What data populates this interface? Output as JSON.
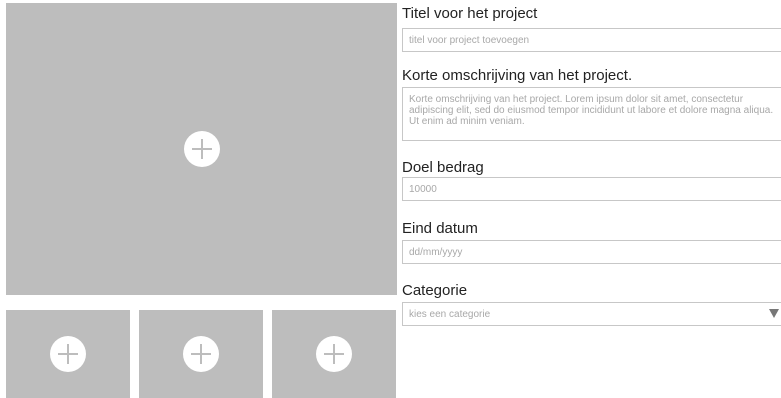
{
  "media": {
    "main": {
      "icon": "plus-circle-icon"
    },
    "thumbnails": [
      {
        "icon": "plus-circle-icon"
      },
      {
        "icon": "plus-circle-icon"
      },
      {
        "icon": "plus-circle-icon"
      }
    ]
  },
  "form": {
    "title": {
      "label": "Titel voor het project",
      "placeholder": "titel voor project toevoegen"
    },
    "description": {
      "label": "Korte omschrijving van het project.",
      "placeholder": "Korte omschrijving van het project. Lorem ipsum dolor sit amet, consectetur adipiscing elit, sed do eiusmod tempor incididunt ut labore et dolore magna aliqua. Ut enim ad minim veniam."
    },
    "goal": {
      "label": "Doel bedrag",
      "placeholder": "10000"
    },
    "end_date": {
      "label": "Eind datum",
      "placeholder": "dd/mm/yyyy"
    },
    "category": {
      "label": "Categorie",
      "placeholder": "kies een categorie",
      "icon": "triangle-down-icon"
    }
  },
  "colors": {
    "placeholder_bg": "#bdbdbd",
    "border": "#c7c7c7",
    "placeholder_text": "#a8a8a8"
  }
}
